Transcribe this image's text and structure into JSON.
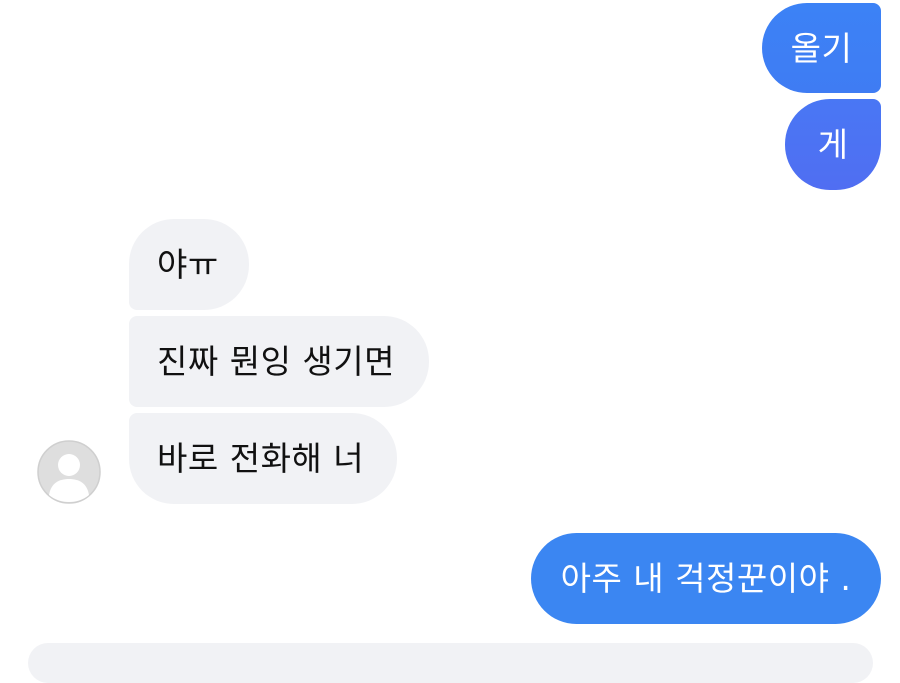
{
  "messages": {
    "sent": [
      "올기",
      "게",
      "아주 내 걱정꾼이야 ."
    ],
    "received": [
      "야ㅠ",
      "진짜 뭔잉 생기면",
      "바로 전화해 너"
    ]
  },
  "colors": {
    "sent_bubble": "#3b86f2",
    "received_bubble": "#f1f2f5",
    "avatar_placeholder": "#d9d9d9"
  },
  "icons": {
    "avatar": "default-user-avatar"
  }
}
